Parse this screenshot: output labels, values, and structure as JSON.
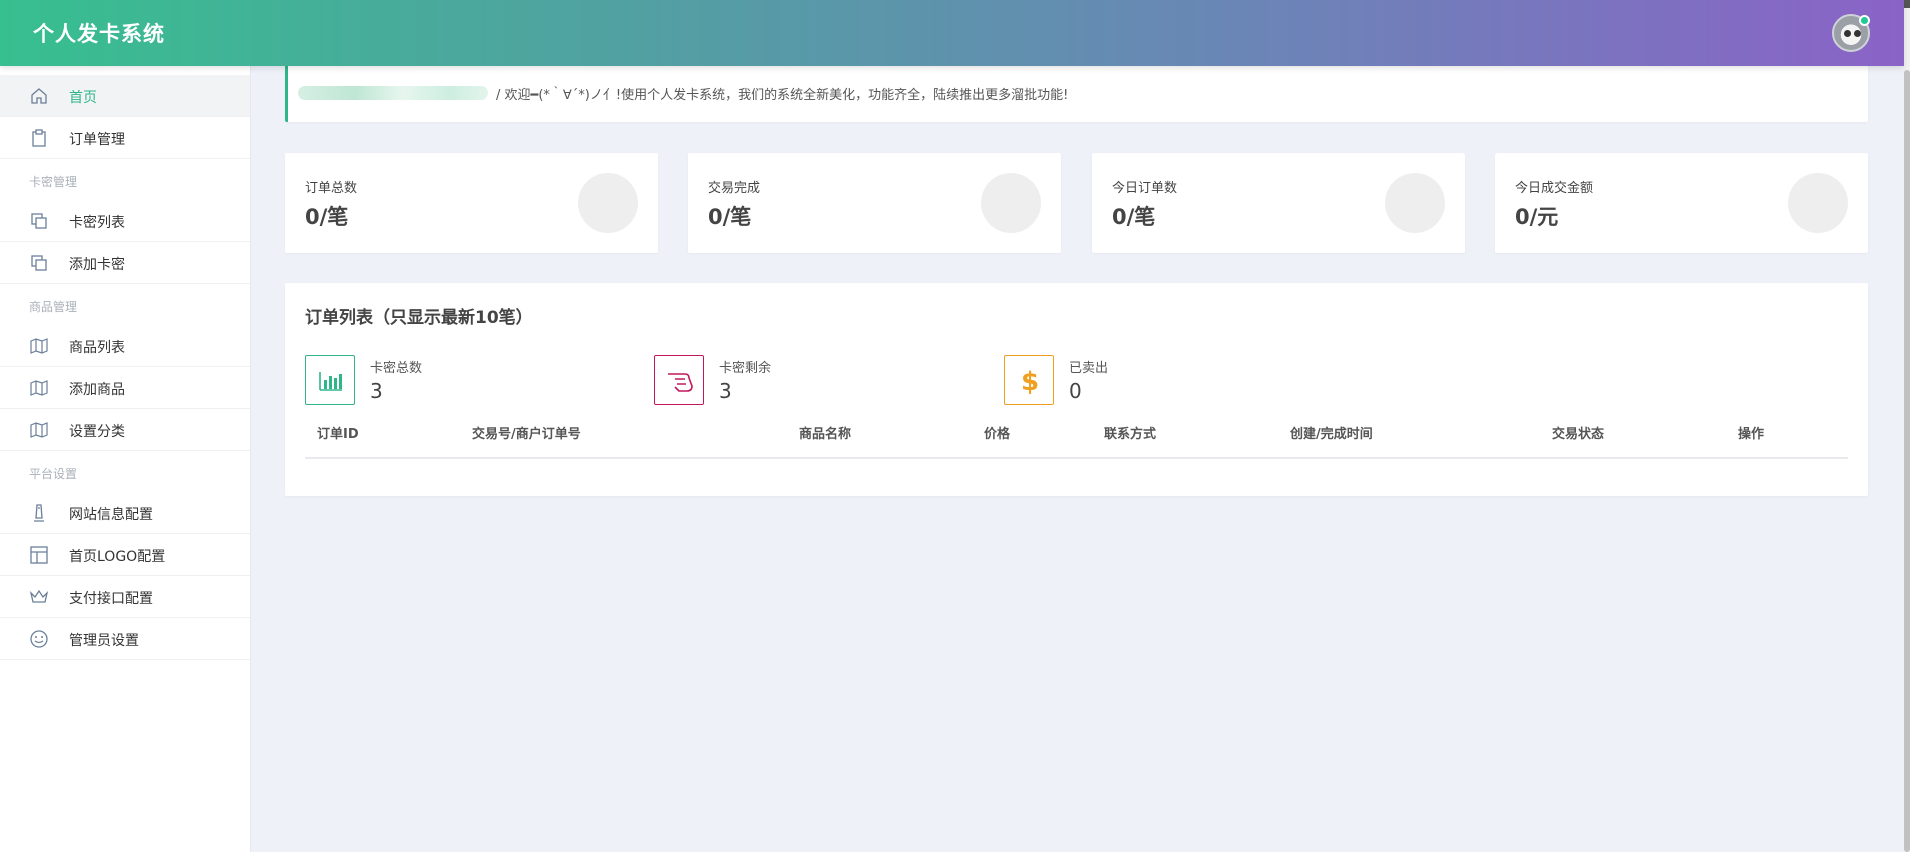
{
  "header": {
    "title": "个人发卡系统"
  },
  "sidebar": {
    "items": [
      {
        "label": "首页",
        "icon": "home-icon",
        "active": true
      },
      {
        "label": "订单管理",
        "icon": "clipboard-icon"
      },
      {
        "label": "卡密列表",
        "icon": "copy-icon"
      },
      {
        "label": "添加卡密",
        "icon": "copy-icon"
      },
      {
        "label": "商品列表",
        "icon": "map-icon"
      },
      {
        "label": "添加商品",
        "icon": "map-icon"
      },
      {
        "label": "设置分类",
        "icon": "map-icon"
      },
      {
        "label": "网站信息配置",
        "icon": "tower-icon"
      },
      {
        "label": "首页LOGO配置",
        "icon": "layout-icon"
      },
      {
        "label": "支付接口配置",
        "icon": "crown-icon"
      },
      {
        "label": "管理员设置",
        "icon": "smile-icon"
      }
    ],
    "groups": [
      "卡密管理",
      "商品管理",
      "平台设置"
    ]
  },
  "welcome": {
    "message": "/  欢迎━(*｀∀´*)ノ亻!使用个人发卡系统，我们的系统全新美化，功能齐全，陆续推出更多溜批功能!"
  },
  "stats": [
    {
      "label": "订单总数",
      "value": "0/笔"
    },
    {
      "label": "交易完成",
      "value": "0/笔"
    },
    {
      "label": "今日订单数",
      "value": "0/笔"
    },
    {
      "label": "今日成交金额",
      "value": "0/元"
    }
  ],
  "orders": {
    "title": "订单列表（只显示最新10笔）",
    "summary": [
      {
        "label": "卡密总数",
        "value": "3",
        "icon": "bar-chart-icon",
        "color": "#2fb58a"
      },
      {
        "label": "卡密剩余",
        "value": "3",
        "icon": "hand-icon",
        "color": "#c2185b"
      },
      {
        "label": "已卖出",
        "value": "0",
        "icon": "dollar-icon",
        "color": "#f0a020"
      }
    ],
    "columns": [
      "订单ID",
      "交易号/商户订单号",
      "商品名称",
      "价格",
      "联系方式",
      "创建/完成时间",
      "交易状态",
      "操作"
    ]
  },
  "colors": {
    "accent": "#2fb58a",
    "gradient_start": "#37bf8f",
    "gradient_end": "#8a63c7"
  }
}
